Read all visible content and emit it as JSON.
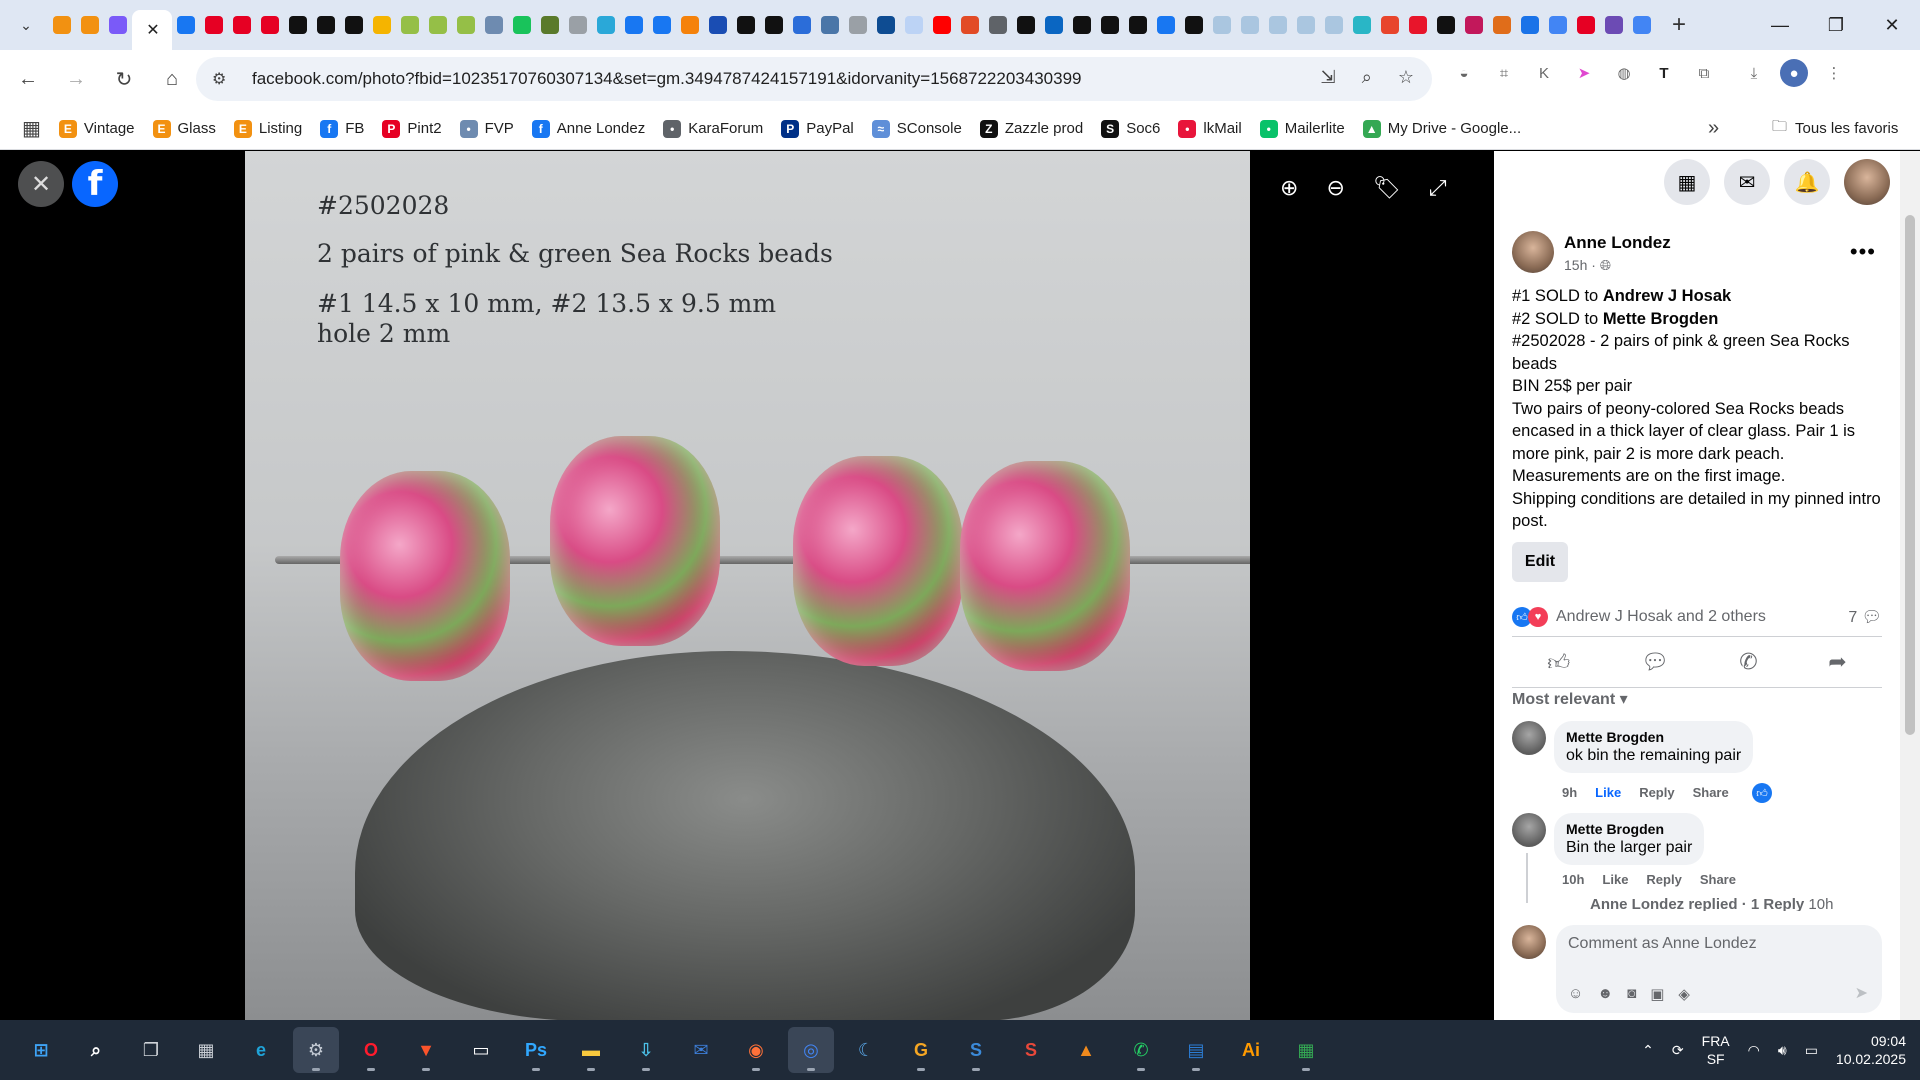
{
  "browser": {
    "url": "facebook.com/photo?fbid=10235170760307134&set=gm.3494787424157191&idorvanity=1568722203430399",
    "tab_favicons": [
      "#f29111",
      "#f29111",
      "#7a5af8",
      "#ffffff",
      "#1877f2",
      "#e60023",
      "#e60023",
      "#e60023",
      "#111111",
      "#111111",
      "#111111",
      "#f5b400",
      "#95bf47",
      "#95bf47",
      "#95bf47",
      "#6e8bb0",
      "#19c35b",
      "#5a7a2b",
      "#9aa0a6",
      "#2aa8d8",
      "#1877f2",
      "#1877f2",
      "#f5820b",
      "#1a4db3",
      "#111111",
      "#111111",
      "#2b6dd9",
      "#4a76a8",
      "#9aa0a6",
      "#0e4c92",
      "#bcd3f5",
      "#ff0000",
      "#e24b26",
      "#5f6368",
      "#111111",
      "#0a66c2",
      "#111111",
      "#111111",
      "#111111",
      "#1877f2",
      "#111111",
      "#aac6e0",
      "#aac6e0",
      "#aac6e0",
      "#aac6e0",
      "#aac6e0",
      "#29b6c6",
      "#e8452c",
      "#e8152b",
      "#111111",
      "#c2185b",
      "#e06d1a",
      "#1a73e8",
      "#4285f4",
      "#e60023",
      "#6c4bb4",
      "#4285f4"
    ],
    "new_tab_label": "+",
    "bookmarks": [
      {
        "label": "Vintage",
        "color": "#f29111",
        "glyph": "E"
      },
      {
        "label": "Glass",
        "color": "#f29111",
        "glyph": "E"
      },
      {
        "label": "Listing",
        "color": "#f29111",
        "glyph": "E"
      },
      {
        "label": "FB",
        "color": "#1877f2",
        "glyph": "f"
      },
      {
        "label": "Pint2",
        "color": "#e60023",
        "glyph": "P"
      },
      {
        "label": "FVP",
        "color": "#6e8bb0",
        "glyph": "•"
      },
      {
        "label": "Anne Londez",
        "color": "#1877f2",
        "glyph": "f"
      },
      {
        "label": "KaraForum",
        "color": "#5f6368",
        "glyph": "•"
      },
      {
        "label": "PayPal",
        "color": "#003087",
        "glyph": "P"
      },
      {
        "label": "SConsole",
        "color": "#5f8fd8",
        "glyph": "≈"
      },
      {
        "label": "Zazzle prod",
        "color": "#111111",
        "glyph": "Z"
      },
      {
        "label": "Soc6",
        "color": "#111111",
        "glyph": "S"
      },
      {
        "label": "lkMail",
        "color": "#e8153b",
        "glyph": "•"
      },
      {
        "label": "Mailerlite",
        "color": "#09c269",
        "glyph": "•"
      },
      {
        "label": "My Drive - Google...",
        "color": "#34a853",
        "glyph": "▲"
      }
    ],
    "bookmarks_all_label": "Tous les favoris"
  },
  "photo": {
    "line1": "#2502028",
    "line2": "2 pairs of pink & green Sea Rocks beads",
    "line3": "#1 14.5 x 10 mm, #2 13.5 x 9.5 mm",
    "line4": "hole 2 mm"
  },
  "post": {
    "author": "Anne Londez",
    "time": "15h ·",
    "sold1_prefix": "#1 SOLD to ",
    "sold1_name": "Andrew J Hosak",
    "sold2_prefix": "#2 SOLD to ",
    "sold2_name": "Mette Brogden",
    "body1": "#2502028 - 2 pairs of pink & green Sea Rocks beads",
    "body2": "BIN 25$ per pair",
    "body3": "Two pairs of peony-colored Sea Rocks beads encased in a thick layer of clear glass. Pair 1 is more pink, pair 2 is more dark peach.",
    "body4": "Measurements are on the first image.",
    "body5": "Shipping conditions are detailed in my pinned intro post.",
    "edit_label": "Edit",
    "reactions_text": "Andrew J Hosak and 2 others",
    "comment_count": "7",
    "sort_label": "Most relevant"
  },
  "comments": [
    {
      "name": "Mette Brogden",
      "text": "ok bin the remaining pair",
      "time": "9h",
      "like": "Like",
      "reply": "Reply",
      "share": "Share"
    },
    {
      "name": "Mette Brogden",
      "text": "Bin the larger pair",
      "time": "10h",
      "like": "Like",
      "reply": "Reply",
      "share": "Share"
    }
  ],
  "reply_summary": {
    "name": "Anne Londez replied",
    "count": "· 1 Reply",
    "time": "10h"
  },
  "comment_box": {
    "placeholder": "Comment as Anne Londez"
  },
  "taskbar": {
    "apps": [
      {
        "name": "start",
        "color": "#3ea3f5",
        "glyph": "⊞"
      },
      {
        "name": "search",
        "color": "#ffffff",
        "glyph": "⌕"
      },
      {
        "name": "task-view",
        "color": "#d0d4da",
        "glyph": "❐"
      },
      {
        "name": "calculator",
        "color": "#c8cdd4",
        "glyph": "▦"
      },
      {
        "name": "edge",
        "color": "#1fa3d8",
        "glyph": "e"
      },
      {
        "name": "settings",
        "color": "#c4cbd4",
        "glyph": "⚙"
      },
      {
        "name": "opera",
        "color": "#ff1b2d",
        "glyph": "O"
      },
      {
        "name": "brave",
        "color": "#fb542b",
        "glyph": "▼"
      },
      {
        "name": "notepad",
        "color": "#ffffff",
        "glyph": "▭"
      },
      {
        "name": "photoshop",
        "color": "#31a8ff",
        "glyph": "Ps"
      },
      {
        "name": "explorer",
        "color": "#f8c93e",
        "glyph": "▬"
      },
      {
        "name": "installer",
        "color": "#4bc0e8",
        "glyph": "⇩"
      },
      {
        "name": "thunderbird",
        "color": "#3d7ed8",
        "glyph": "✉"
      },
      {
        "name": "firefox",
        "color": "#ff7139",
        "glyph": "◉"
      },
      {
        "name": "chrome",
        "color": "#4285f4",
        "glyph": "◎"
      },
      {
        "name": "app-blue",
        "color": "#5aa7e8",
        "glyph": "☾"
      },
      {
        "name": "app-g",
        "color": "#f5a623",
        "glyph": "G"
      },
      {
        "name": "app-s-blue",
        "color": "#3b8ad9",
        "glyph": "S"
      },
      {
        "name": "app-s-red",
        "color": "#e8483a",
        "glyph": "S"
      },
      {
        "name": "vlc",
        "color": "#f08a1d",
        "glyph": "▲"
      },
      {
        "name": "whatsapp",
        "color": "#25d366",
        "glyph": "✆"
      },
      {
        "name": "word-doc",
        "color": "#2b7cd3",
        "glyph": "▤"
      },
      {
        "name": "illustrator",
        "color": "#ff9a00",
        "glyph": "Ai"
      },
      {
        "name": "sheets",
        "color": "#34a853",
        "glyph": "▦"
      }
    ],
    "lang": "FRA",
    "lang_sub": "SF",
    "time": "09:04",
    "date": "10.02.2025"
  }
}
